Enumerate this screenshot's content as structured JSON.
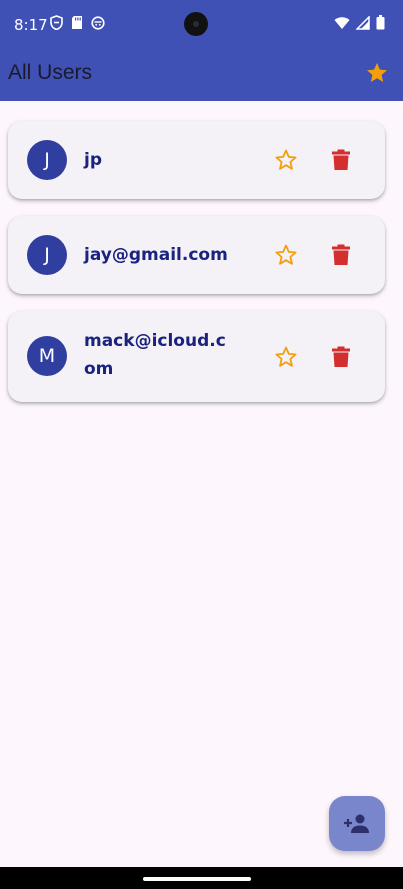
{
  "status_bar": {
    "time": "8:17"
  },
  "app_bar": {
    "title": "All Users",
    "accent_color": "#3f51b5",
    "favorites_icon": "star-filled-icon",
    "favorites_color": "#f59e0b"
  },
  "users": [
    {
      "initial": "J",
      "email": "jp",
      "favorite_icon": "star-outline-icon",
      "delete_icon": "trash-icon"
    },
    {
      "initial": "J",
      "email": "jay@gmail.com",
      "favorite_icon": "star-outline-icon",
      "delete_icon": "trash-icon"
    },
    {
      "initial": "M",
      "email": "mack@icloud.com",
      "favorite_icon": "star-outline-icon",
      "delete_icon": "trash-icon"
    }
  ],
  "colors": {
    "avatar": "#303f9f",
    "email_text": "#1a237e",
    "star": "#f59e0b",
    "delete": "#d32f2f",
    "fab": "#7986cb"
  },
  "fab": {
    "icon": "person-add-icon"
  }
}
